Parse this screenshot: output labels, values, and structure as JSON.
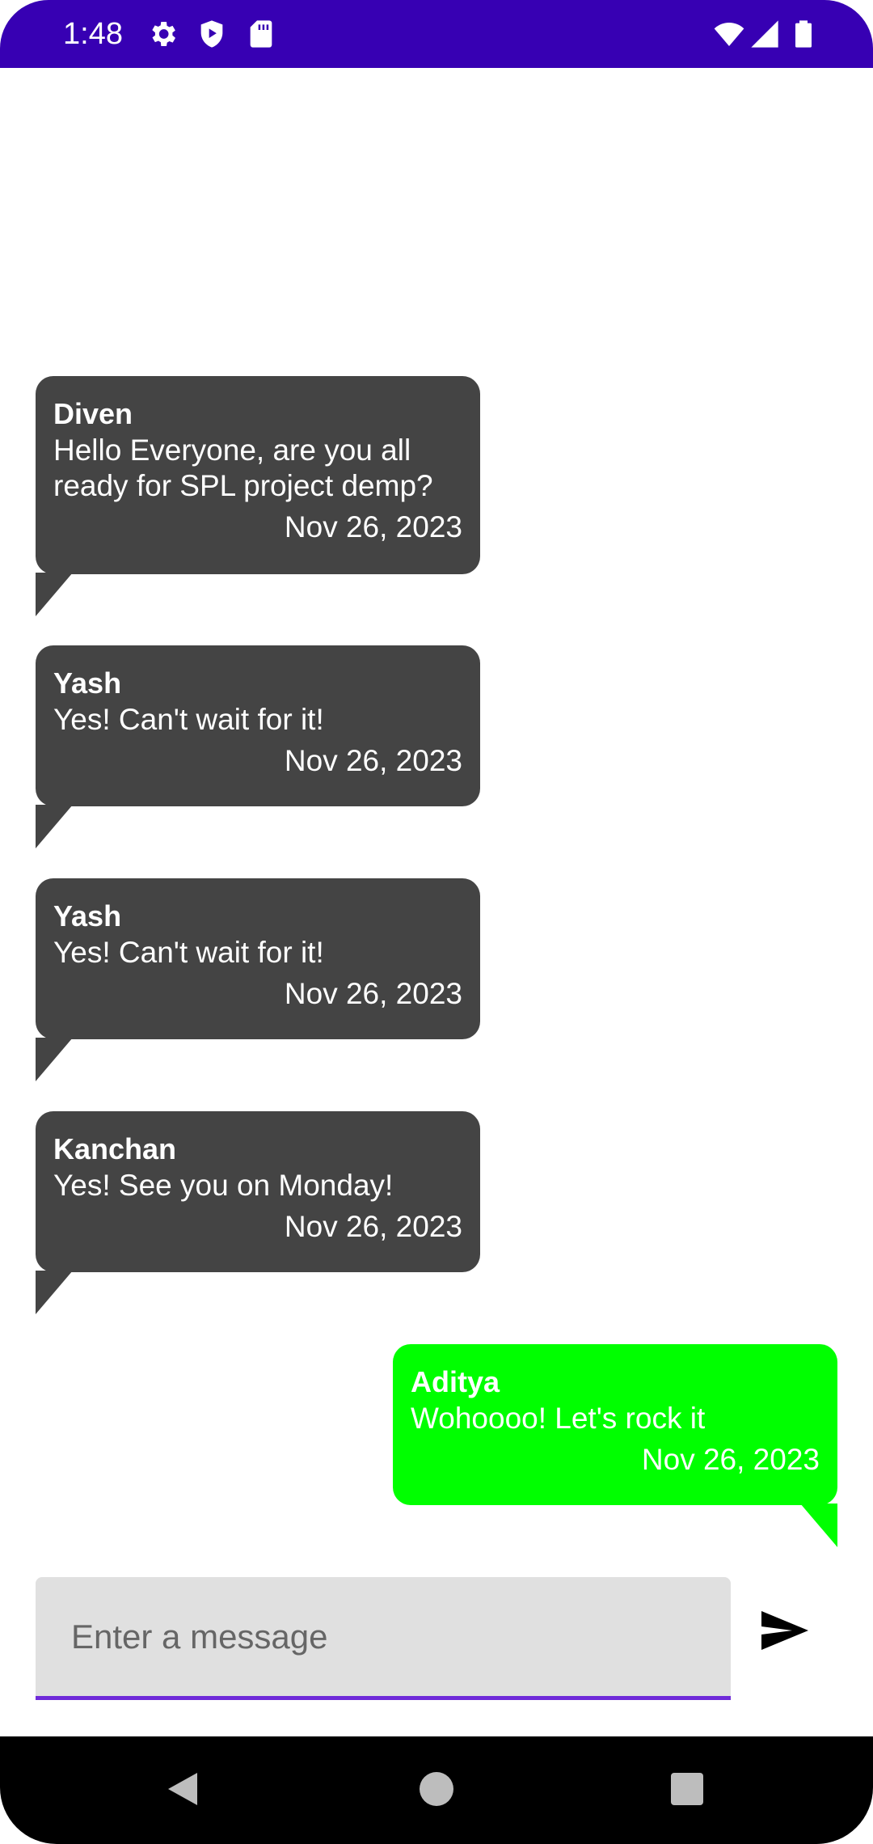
{
  "status_bar": {
    "time": "1:48",
    "left_icons": [
      "gear-icon",
      "shield-play-icon",
      "sd-card-icon"
    ],
    "right_icons": [
      "wifi-icon",
      "cellular-signal-icon",
      "battery-icon"
    ],
    "background": "#3700b3"
  },
  "messages": [
    {
      "sender": "Diven",
      "text": "Hello Everyone, are you all ready for SPL project demp?",
      "date": "Nov 26, 2023",
      "outgoing": false
    },
    {
      "sender": "Yash",
      "text": "Yes! Can't wait for it!",
      "date": "Nov 26, 2023",
      "outgoing": false
    },
    {
      "sender": "Yash",
      "text": "Yes! Can't wait for it!",
      "date": "Nov 26, 2023",
      "outgoing": false
    },
    {
      "sender": "Kanchan",
      "text": "Yes! See you on Monday!",
      "date": "Nov 26, 2023",
      "outgoing": false
    },
    {
      "sender": "Aditya",
      "text": "Wohoooo! Let's rock it",
      "date": "Nov 26, 2023",
      "outgoing": true
    }
  ],
  "composer": {
    "placeholder": "Enter a message",
    "value": "",
    "send_icon": "send-icon",
    "underline_color": "#6f2bd9"
  },
  "colors": {
    "incoming_bubble": "#444444",
    "outgoing_bubble": "#00ff00"
  },
  "nav_bar": {
    "buttons": [
      "back-icon",
      "home-icon",
      "recents-icon"
    ]
  }
}
